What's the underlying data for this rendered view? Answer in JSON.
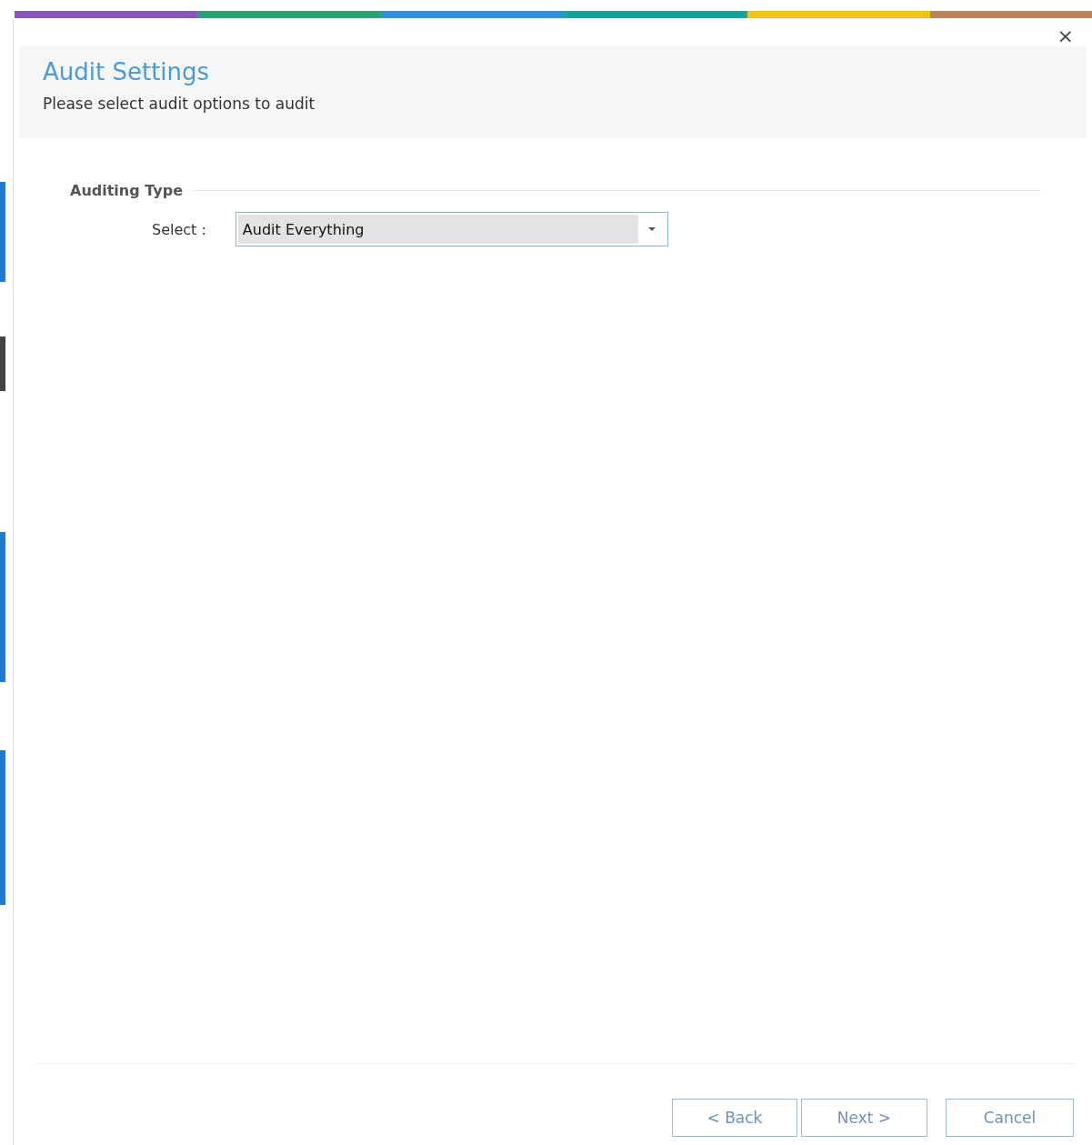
{
  "dialog": {
    "close": "×",
    "title": "Audit Settings",
    "subtitle": "Please select audit options to audit"
  },
  "group": {
    "title": "Auditing Type",
    "field_label": "Select :",
    "dropdown": {
      "value": "Audit Everything"
    }
  },
  "buttons": [
    "< Back",
    "Next >",
    "Cancel"
  ]
}
